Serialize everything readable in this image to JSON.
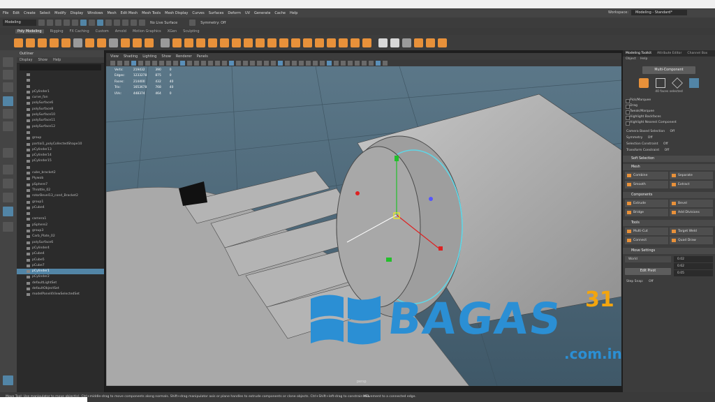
{
  "menu": [
    "File",
    "Edit",
    "Create",
    "Select",
    "Modify",
    "Display",
    "Windows",
    "Mesh",
    "Edit Mesh",
    "Mesh Tools",
    "Mesh Display",
    "Curves",
    "Surfaces",
    "Deform",
    "UV",
    "Generate",
    "Cache",
    "Help"
  ],
  "workspace": {
    "label": "Workspace:",
    "value": "Modeling - Standard*"
  },
  "status_line": {
    "mode": "Modeling",
    "live_surface": "No Live Surface",
    "symmetry": "Symmetry: Off"
  },
  "shelf_tabs": [
    "Poly Modeling",
    "Rigging",
    "FX Caching",
    "Custom",
    "Arnold",
    "Motion Graphics",
    "XGen",
    "Sculpting"
  ],
  "outliner": {
    "title": "Outliner",
    "menu": [
      "Display",
      "Show",
      "Help"
    ],
    "items": [
      "",
      "",
      "",
      "pCylinder1",
      "curve_fan",
      "polySurface6",
      "polySurface8",
      "polySurface10",
      "polySurface11",
      "polySurface12",
      "",
      "group",
      "partial1_polyCollectedShape10",
      "pCylinder13",
      "pCylinder14",
      "pCylinder15",
      "",
      "cube_bracket2",
      "Plywob",
      "pSphere7",
      "Throttle_02",
      "rotorBevel13_cond_Bracket2",
      "group1",
      "pCube4",
      "",
      "camera1",
      "pSphere2",
      "group3",
      "Carb_Plate_02",
      "polySurface6",
      "pCylinder4",
      "pCube4",
      "pCube5",
      "pCube7",
      "pCylinder1",
      "pCylinder2",
      "defaultLightSet",
      "defaultObjectSet",
      "modelPanel4ViewSelectedSet"
    ],
    "selected_index": 34
  },
  "viewport": {
    "menu": [
      "View",
      "Shading",
      "Lighting",
      "Show",
      "Renderer",
      "Panels"
    ],
    "hud": [
      {
        "label": "Verts:",
        "a": "219432",
        "b": "390",
        "c": "0"
      },
      {
        "label": "Edges:",
        "a": "1233278",
        "b": "875",
        "c": "0"
      },
      {
        "label": "Faces:",
        "a": "214400",
        "b": "432",
        "c": "40"
      },
      {
        "label": "Tris:",
        "a": "1653678",
        "b": "768",
        "c": "40"
      },
      {
        "label": "UVs:",
        "a": "448374",
        "b": "464",
        "c": "0"
      }
    ],
    "camera": "persp"
  },
  "watermark": {
    "main": "BAGAS",
    "sup": "31",
    "domain": ".com.in"
  },
  "toolkit": {
    "tabs": [
      "Modeling Toolkit",
      "Attribute Editor",
      "Channel Box"
    ],
    "sub": [
      "Object",
      "Help"
    ],
    "multi_component": "Multi-Component",
    "faces_selected": "40 faces selected",
    "options": [
      "Pick/Marquee",
      "Drag",
      "Tweak/Marquee",
      "Highlight Backfaces",
      "Highlight Nearest Component"
    ],
    "camera_based": "Camera Based Selection",
    "symmetry": "Symmetry",
    "selection_constraint": "Selection Constraint",
    "transform_constraint": "Transform Constraint",
    "off": "Off",
    "soft_selection": "Soft Selection",
    "sections": [
      {
        "title": "Mesh",
        "items": [
          "Combine",
          "Separate",
          "Smooth",
          "Extract"
        ]
      },
      {
        "title": "Components",
        "items": [
          "Extrude",
          "Bevel",
          "Bridge",
          "Add Divisions"
        ]
      },
      {
        "title": "Tools",
        "items": [
          "Multi-Cut",
          "Target Weld",
          "Connect",
          "Quad Draw"
        ]
      }
    ],
    "move_settings": "Move Settings",
    "world": "World",
    "edit_pivot": "Edit Pivot",
    "move_values": [
      "0.02",
      "0.62",
      "0.05"
    ],
    "step_snap": "Step Snap:"
  },
  "help_line": "Move Tool: Use manipulator to move object(s). Ctrl+middle-drag to move components along normals. Shift+drag manipulator axis or plane handles to extrude components or clone objects. Ctrl+Shift+left-drag to constrain movement to a connected edge.",
  "command_line_label": "MEL"
}
